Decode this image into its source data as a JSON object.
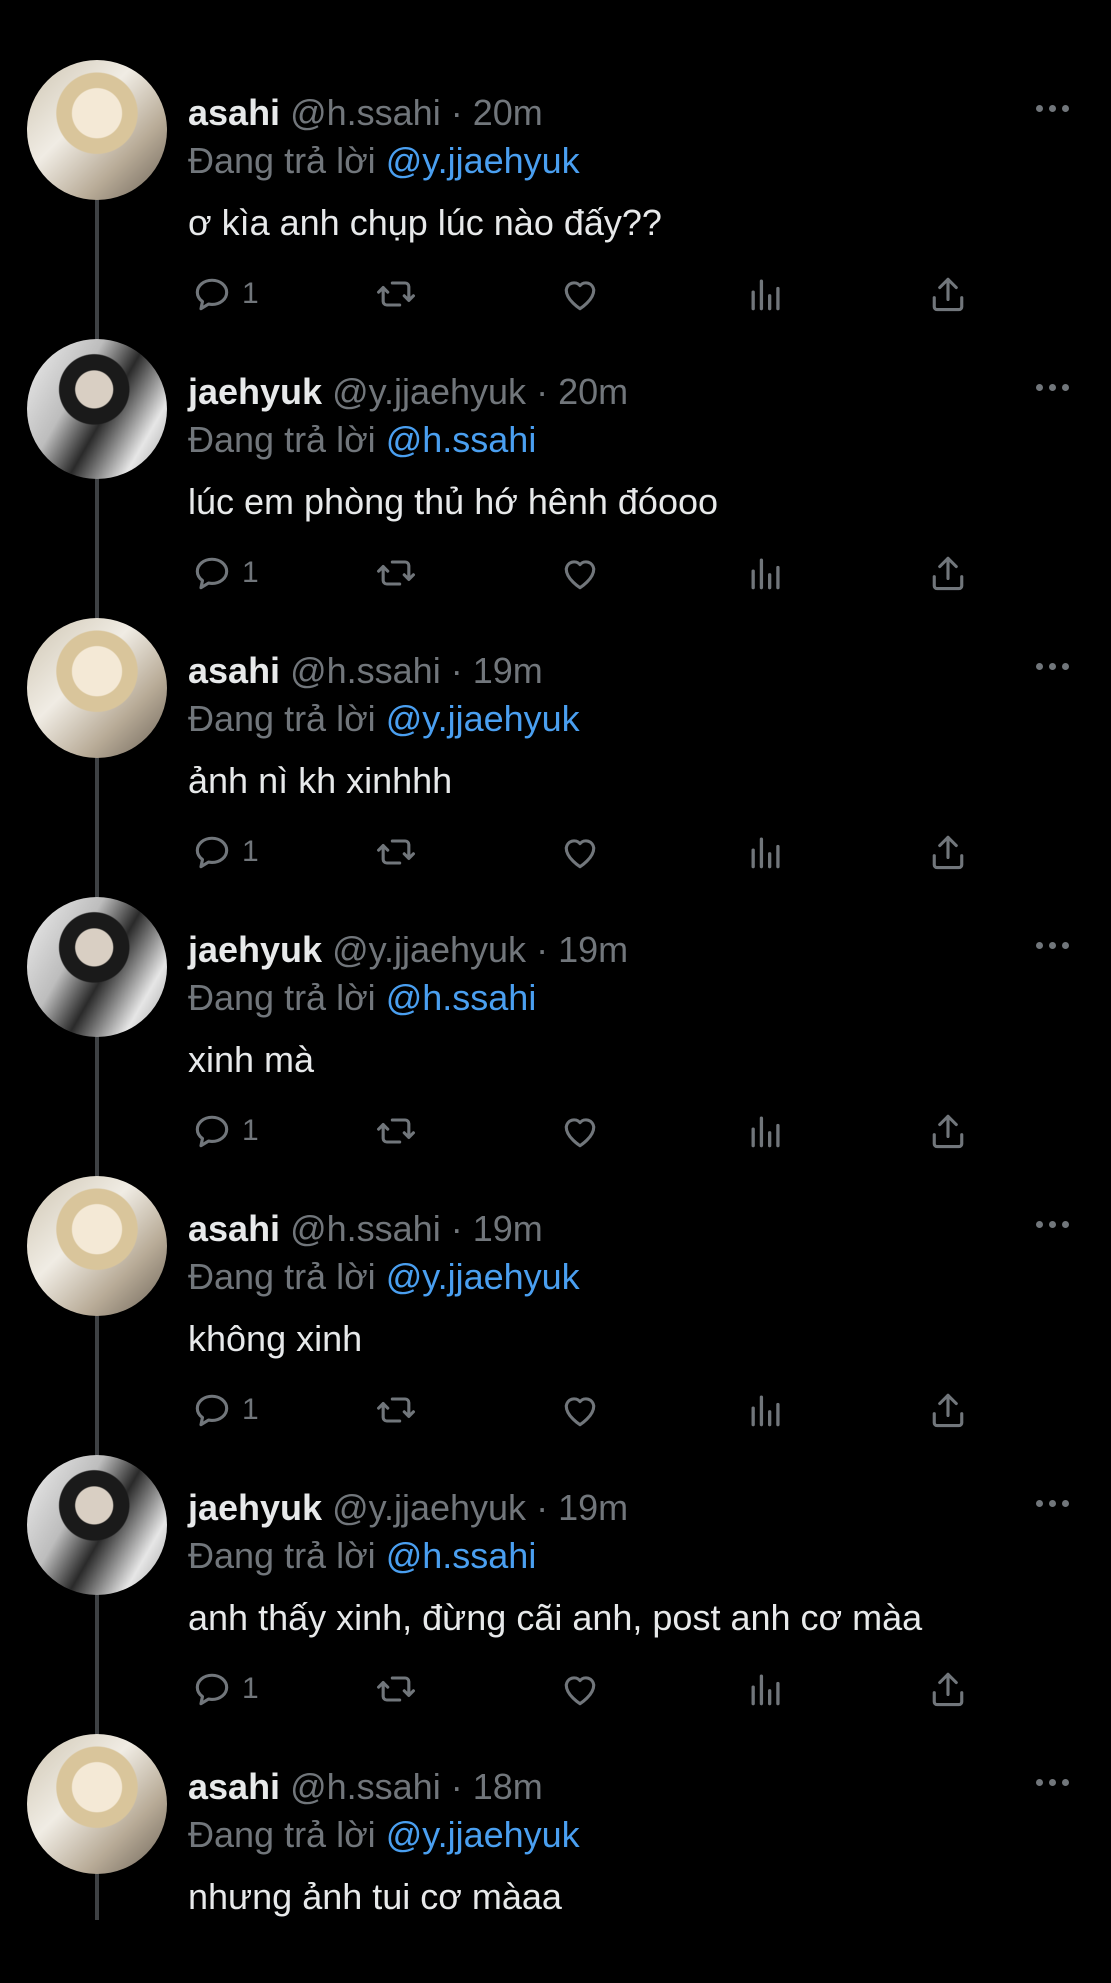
{
  "tweets": [
    {
      "avatar": "asahi",
      "name": "asahi",
      "handle": "@h.ssahi",
      "sep": "·",
      "time": "20m",
      "reply_prefix": "Đang trả lời",
      "reply_to": "@y.jjaehyuk",
      "text": "ơ kìa anh chụp lúc nào đấy??",
      "reply_count": "1"
    },
    {
      "avatar": "jaehyuk",
      "name": "jaehyuk",
      "handle": "@y.jjaehyuk",
      "sep": "·",
      "time": "20m",
      "reply_prefix": "Đang trả lời",
      "reply_to": "@h.ssahi",
      "text": "lúc em phòng thủ hớ hênh đóooo",
      "reply_count": "1"
    },
    {
      "avatar": "asahi",
      "name": "asahi",
      "handle": "@h.ssahi",
      "sep": "·",
      "time": "19m",
      "reply_prefix": "Đang trả lời",
      "reply_to": "@y.jjaehyuk",
      "text": "ảnh nì kh xinhhh",
      "reply_count": "1"
    },
    {
      "avatar": "jaehyuk",
      "name": "jaehyuk",
      "handle": "@y.jjaehyuk",
      "sep": "·",
      "time": "19m",
      "reply_prefix": "Đang trả lời",
      "reply_to": "@h.ssahi",
      "text": "xinh mà",
      "reply_count": "1"
    },
    {
      "avatar": "asahi",
      "name": "asahi",
      "handle": "@h.ssahi",
      "sep": "·",
      "time": "19m",
      "reply_prefix": "Đang trả lời",
      "reply_to": "@y.jjaehyuk",
      "text": "không xinh",
      "reply_count": "1"
    },
    {
      "avatar": "jaehyuk",
      "name": "jaehyuk",
      "handle": "@y.jjaehyuk",
      "sep": "·",
      "time": "19m",
      "reply_prefix": "Đang trả lời",
      "reply_to": "@h.ssahi",
      "text": "anh thấy xinh, đừng cãi anh, post anh cơ màa",
      "reply_count": "1"
    },
    {
      "avatar": "asahi",
      "name": "asahi",
      "handle": "@h.ssahi",
      "sep": "·",
      "time": "18m",
      "reply_prefix": "Đang trả lời",
      "reply_to": "@y.jjaehyuk",
      "text": "nhưng ảnh tui cơ màaa",
      "reply_count": ""
    }
  ],
  "colors": {
    "background": "#000000",
    "text": "#e7e9ea",
    "muted": "#71767b",
    "link": "#4a9ff0"
  },
  "icons": [
    "reply-icon",
    "retweet-icon",
    "like-icon",
    "views-icon",
    "share-icon",
    "more-icon"
  ]
}
